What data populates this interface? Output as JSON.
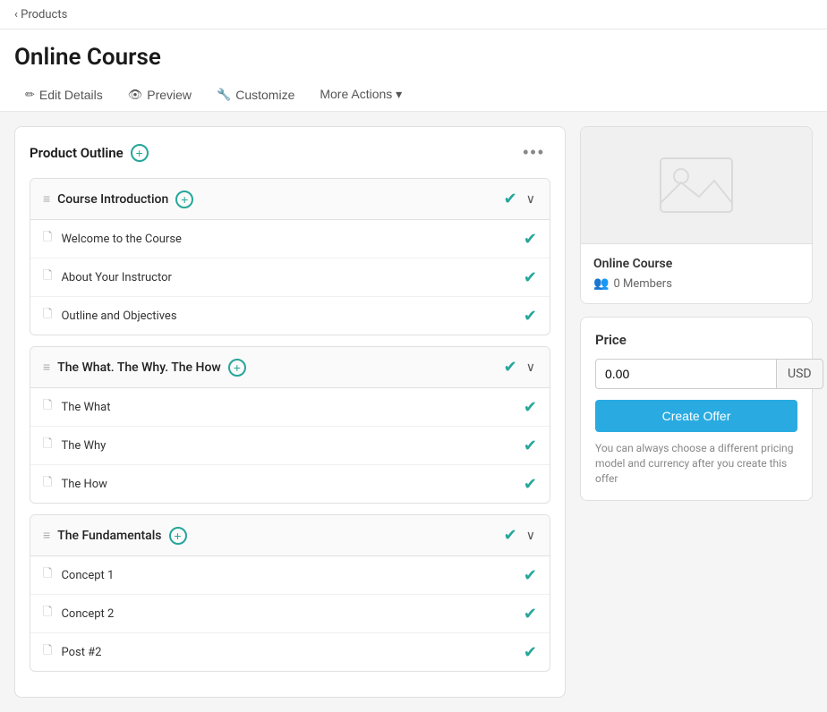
{
  "breadcrumb": {
    "label": "Products"
  },
  "header": {
    "title": "Online Course",
    "toolbar": [
      {
        "id": "edit-details",
        "label": "Edit Details",
        "icon": "✏"
      },
      {
        "id": "preview",
        "label": "Preview",
        "icon": "👁"
      },
      {
        "id": "customize",
        "label": "Customize",
        "icon": "🔧"
      },
      {
        "id": "more-actions",
        "label": "More Actions ▾",
        "icon": ""
      }
    ]
  },
  "outline": {
    "title": "Product Outline",
    "sections": [
      {
        "id": "section-1",
        "name": "Course Introduction",
        "lessons": [
          {
            "id": "l1",
            "name": "Welcome to the Course"
          },
          {
            "id": "l2",
            "name": "About Your Instructor"
          },
          {
            "id": "l3",
            "name": "Outline and Objectives"
          }
        ]
      },
      {
        "id": "section-2",
        "name": "The What. The Why. The How",
        "lessons": [
          {
            "id": "l4",
            "name": "The What"
          },
          {
            "id": "l5",
            "name": "The Why"
          },
          {
            "id": "l6",
            "name": "The How"
          }
        ]
      },
      {
        "id": "section-3",
        "name": "The Fundamentals",
        "lessons": [
          {
            "id": "l7",
            "name": "Concept 1"
          },
          {
            "id": "l8",
            "name": "Concept 2"
          },
          {
            "id": "l9",
            "name": "Post #2"
          }
        ]
      }
    ]
  },
  "preview": {
    "course_title": "Online Course",
    "members_count": "0 Members"
  },
  "price": {
    "label": "Price",
    "value": "0.00",
    "currency": "USD",
    "create_offer_label": "Create Offer",
    "note": "You can always choose a different pricing model and currency after you create this offer"
  },
  "icons": {
    "check": "✔",
    "drag": "≡",
    "doc": "🗋",
    "add": "+",
    "chevron": "∨",
    "members": "👥",
    "pencil": "✏",
    "eye": "👁",
    "wrench": "🔧",
    "ellipsis": "•••"
  }
}
